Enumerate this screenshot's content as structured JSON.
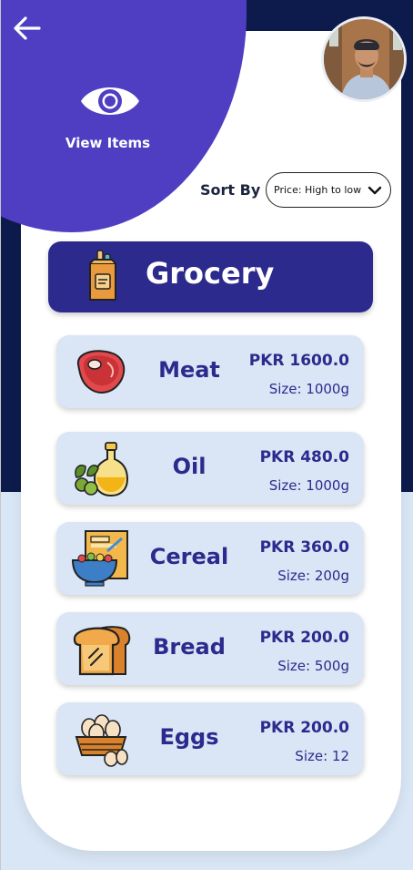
{
  "header": {
    "title": "View Items",
    "back_icon": "arrow-left-icon",
    "eye_icon": "eye-icon"
  },
  "sort": {
    "label": "Sort By",
    "selected": "Price: High to low"
  },
  "category": {
    "title": "Grocery",
    "icon": "grocery-bag-icon"
  },
  "items": [
    {
      "name": "Meat",
      "price": "PKR 1600.0",
      "size": "Size: 1000g",
      "icon": "meat-icon"
    },
    {
      "name": "Oil",
      "price": "PKR 480.0",
      "size": "Size: 1000g",
      "icon": "oil-bottle-icon"
    },
    {
      "name": "Cereal",
      "price": "PKR 360.0",
      "size": "Size: 200g",
      "icon": "cereal-icon"
    },
    {
      "name": "Bread",
      "price": "PKR 200.0",
      "size": "Size: 500g",
      "icon": "bread-icon"
    },
    {
      "name": "Eggs",
      "price": "PKR 200.0",
      "size": "Size: 12",
      "icon": "eggs-icon"
    }
  ],
  "colors": {
    "primary": "#2c2a8c",
    "accent": "#4f3ec2",
    "navy": "#0d1b4c",
    "card_bg": "#dae6f6"
  }
}
